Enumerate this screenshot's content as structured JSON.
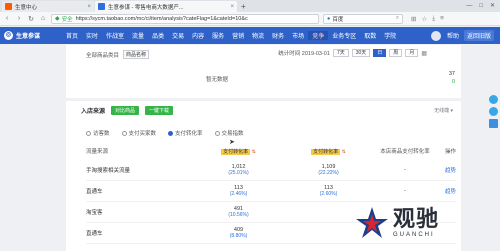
{
  "browser": {
    "tabs": [
      {
        "label": "生意中心",
        "favicon_color": "#ff5a00",
        "active": false
      },
      {
        "label": "生意参谋 - 零售电商大数据产...",
        "favicon_color": "#2b6fe0",
        "active": true
      }
    ],
    "new_tab_symbol": "+",
    "url_secure_label": "安全",
    "url": "https://sycm.taobao.com/mc/ci/item/analysis?cateFlag=1&cateId=10&c",
    "search_engine": "百度",
    "search_icon": "search-icon"
  },
  "sitenav": {
    "brand": "生意参谋",
    "items": [
      "首页",
      "实时",
      "作战室",
      "流量",
      "品类",
      "交易",
      "内容",
      "服务",
      "营销",
      "物流",
      "财务",
      "市场",
      "竞争",
      "业务专区",
      "取数",
      "学院"
    ],
    "highlight_index": 12,
    "right_buttons": [
      "帮助",
      "返回旧版"
    ]
  },
  "card1": {
    "filter_label": "全部商品类目",
    "filter_value": "商品名称",
    "date_prefix": "统计时间 2019-03-01",
    "date_options": [
      "7天",
      "30天",
      "日",
      "周",
      "月"
    ],
    "active_date_index": 2,
    "mid_text": "暂无数据",
    "right_values": [
      "37",
      "0"
    ]
  },
  "card2": {
    "title": "入店来源",
    "buttons": [
      "对比商品",
      "一键下载"
    ],
    "right_text": "无线端 ▾",
    "metric_tabs": [
      {
        "label": "访客数",
        "checked": false
      },
      {
        "label": "支付买家数",
        "checked": false
      },
      {
        "label": "支付转化率",
        "checked": true
      },
      {
        "label": "交易指数",
        "checked": false
      }
    ],
    "columns": {
      "source": "流量来源",
      "col_a": "支付转化率",
      "col_b": "支付转化率",
      "col_c": "本店商品支付转化率",
      "ops": "操作"
    },
    "rows": [
      {
        "source": "手淘搜索相关流量",
        "a": "1,012",
        "a_sub": "(25.01%)",
        "b": "1,109",
        "b_sub": "(22.22%)",
        "c": "-",
        "op": "趋势"
      },
      {
        "source": "直通车",
        "a": "113",
        "a_sub": "(2.46%)",
        "b": "113",
        "b_sub": "(2.60%)",
        "c": "-",
        "op": "趋势"
      },
      {
        "source": "淘宝客",
        "a": "491",
        "a_sub": "(10.56%)",
        "b": "",
        "b_sub": "",
        "c": "-",
        "op": ""
      },
      {
        "source": "直通车",
        "a": "409",
        "a_sub": "(8.80%)",
        "b": "",
        "b_sub": "",
        "c": "",
        "op": ""
      }
    ]
  },
  "watermark": {
    "cn": "观驰",
    "en": "GUANCHI",
    "colors": {
      "navy": "#1f3d8a",
      "red": "#d8262c"
    }
  },
  "colors": {
    "nav_blue": "#2f62c9",
    "green": "#35b548",
    "yellow": "#f7c948"
  }
}
